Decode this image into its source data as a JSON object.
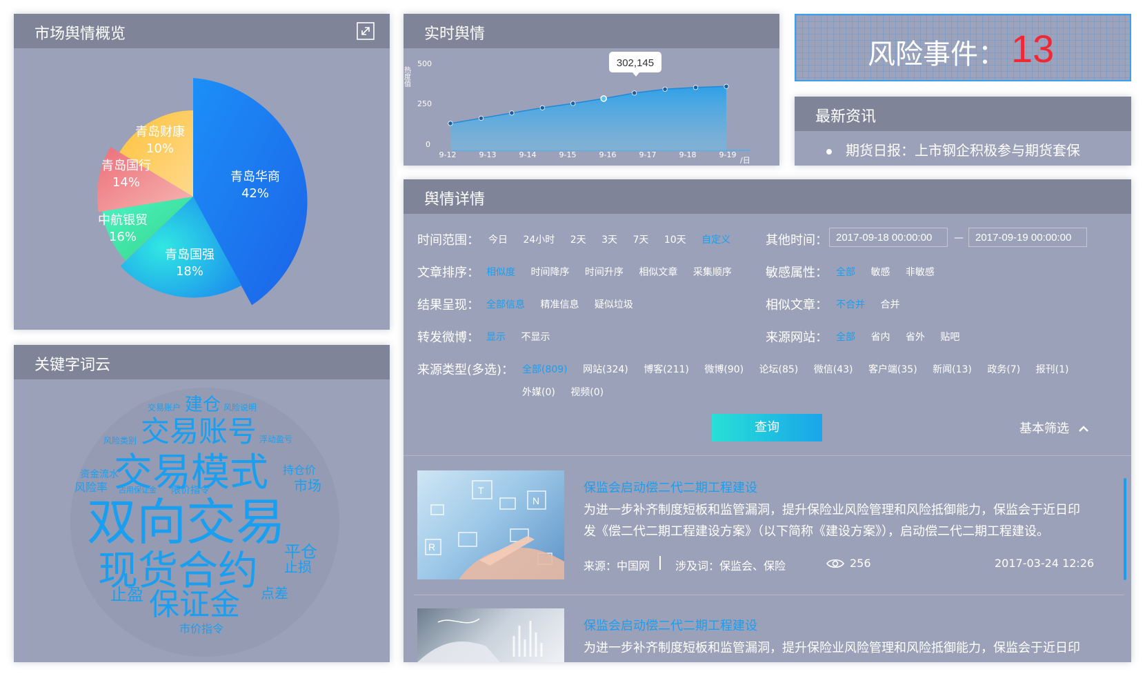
{
  "overview": {
    "title": "市场舆情概览",
    "slices": [
      {
        "name": "青岛华商",
        "pct": "42%",
        "value": 42
      },
      {
        "name": "青岛国强",
        "pct": "18%",
        "value": 18
      },
      {
        "name": "中航银贸",
        "pct": "16%",
        "value": 16
      },
      {
        "name": "青岛国行",
        "pct": "14%",
        "value": 14
      },
      {
        "name": "青岛财康",
        "pct": "10%",
        "value": 10
      }
    ]
  },
  "realtime": {
    "title": "实时舆情",
    "ylabel": "热度值",
    "yticks": [
      "500",
      "250",
      "0"
    ],
    "xunit": "/日",
    "tooltip": "302,145"
  },
  "chart_data": {
    "type": "area",
    "x": [
      "9-12",
      "9-13",
      "9-14",
      "9-15",
      "9-16",
      "9-17",
      "9-18",
      "9-19"
    ],
    "series": [
      {
        "values": [
          155,
          185,
          215,
          245,
          270,
          298,
          330,
          352,
          362,
          368
        ]
      }
    ],
    "x_positions_note": "",
    "ylim": [
      0,
      500
    ],
    "grid": false
  },
  "risk": {
    "label": "风险事件：",
    "count": "13"
  },
  "latest": {
    "title": "最新资讯",
    "items": [
      "期货日报：上市钢企积极参与期货套保"
    ]
  },
  "wordcloud": {
    "title": "关键字词云",
    "words": [
      "交易账户",
      "建仓",
      "风险说明",
      "交易账号",
      "风险类别",
      "浮动盈亏",
      "交易模式",
      "持仓价",
      "资金流水",
      "市场",
      "风险率",
      "占用保证金",
      "限价指令",
      "双向交易",
      "平仓",
      "现货合约",
      "止损",
      "止盈",
      "点差",
      "保证金",
      "市价指令"
    ]
  },
  "details": {
    "title": "舆情详情",
    "time_range": {
      "label": "时间范围：",
      "options": [
        "今日",
        "24小时",
        "2天",
        "3天",
        "7天",
        "10天",
        "自定义"
      ]
    },
    "other_time": {
      "label": "其他时间：",
      "from": "2017-09-18 00:00:00",
      "sep": "—",
      "to": "2017-09-19 00:00:00"
    },
    "sort": {
      "label": "文章排序：",
      "options": [
        "相似度",
        "时间降序",
        "时间升序",
        "相似文章",
        "采集顺序"
      ]
    },
    "sensitive": {
      "label": "敏感属性：",
      "options": [
        "全部",
        "敏感",
        "非敏感"
      ]
    },
    "result": {
      "label": "结果呈现：",
      "options": [
        "全部信息",
        "精准信息",
        "疑似垃圾"
      ]
    },
    "similar": {
      "label": "相似文章：",
      "options": [
        "不合并",
        "合并"
      ]
    },
    "weibo": {
      "label": "转发微博：",
      "options": [
        "显示",
        "不显示"
      ]
    },
    "site": {
      "label": "来源网站：",
      "options": [
        "全部",
        "省内",
        "省外",
        "贴吧"
      ]
    },
    "source_type": {
      "label": "来源类型(多选)：",
      "options": [
        "全部(809)",
        "网站(324)",
        "博客(211)",
        "微博(90)",
        "论坛(85)",
        "微信(43)",
        "客户端(35)",
        "新闻(13)",
        "政务(7)",
        "报刊(1)"
      ],
      "options2": [
        "外媒(0)",
        "视频(0)"
      ]
    },
    "query_label": "查询",
    "basic_filter_label": "基本筛选"
  },
  "articles": [
    {
      "title": "保监会启动偿二代二期工程建设",
      "body1": "为进一步补齐制度短板和监管漏洞，提升保险业风险管理和风险抵御能力，保监会于近日印",
      "body2": "发《偿二代二期工程建设方案》（以下简称《建设方案》），启动偿二代二期工程建设。",
      "source": "来源：中国网",
      "keywords": "涉及词：保监会、保险",
      "views": "256",
      "date": "2017-03-24 12:26"
    },
    {
      "title": "保监会启动偿二代二期工程建设",
      "body1": "为进一步补齐制度短板和监管漏洞，提升保险业风险管理和风险抵御能力，保监会于近日印"
    }
  ]
}
